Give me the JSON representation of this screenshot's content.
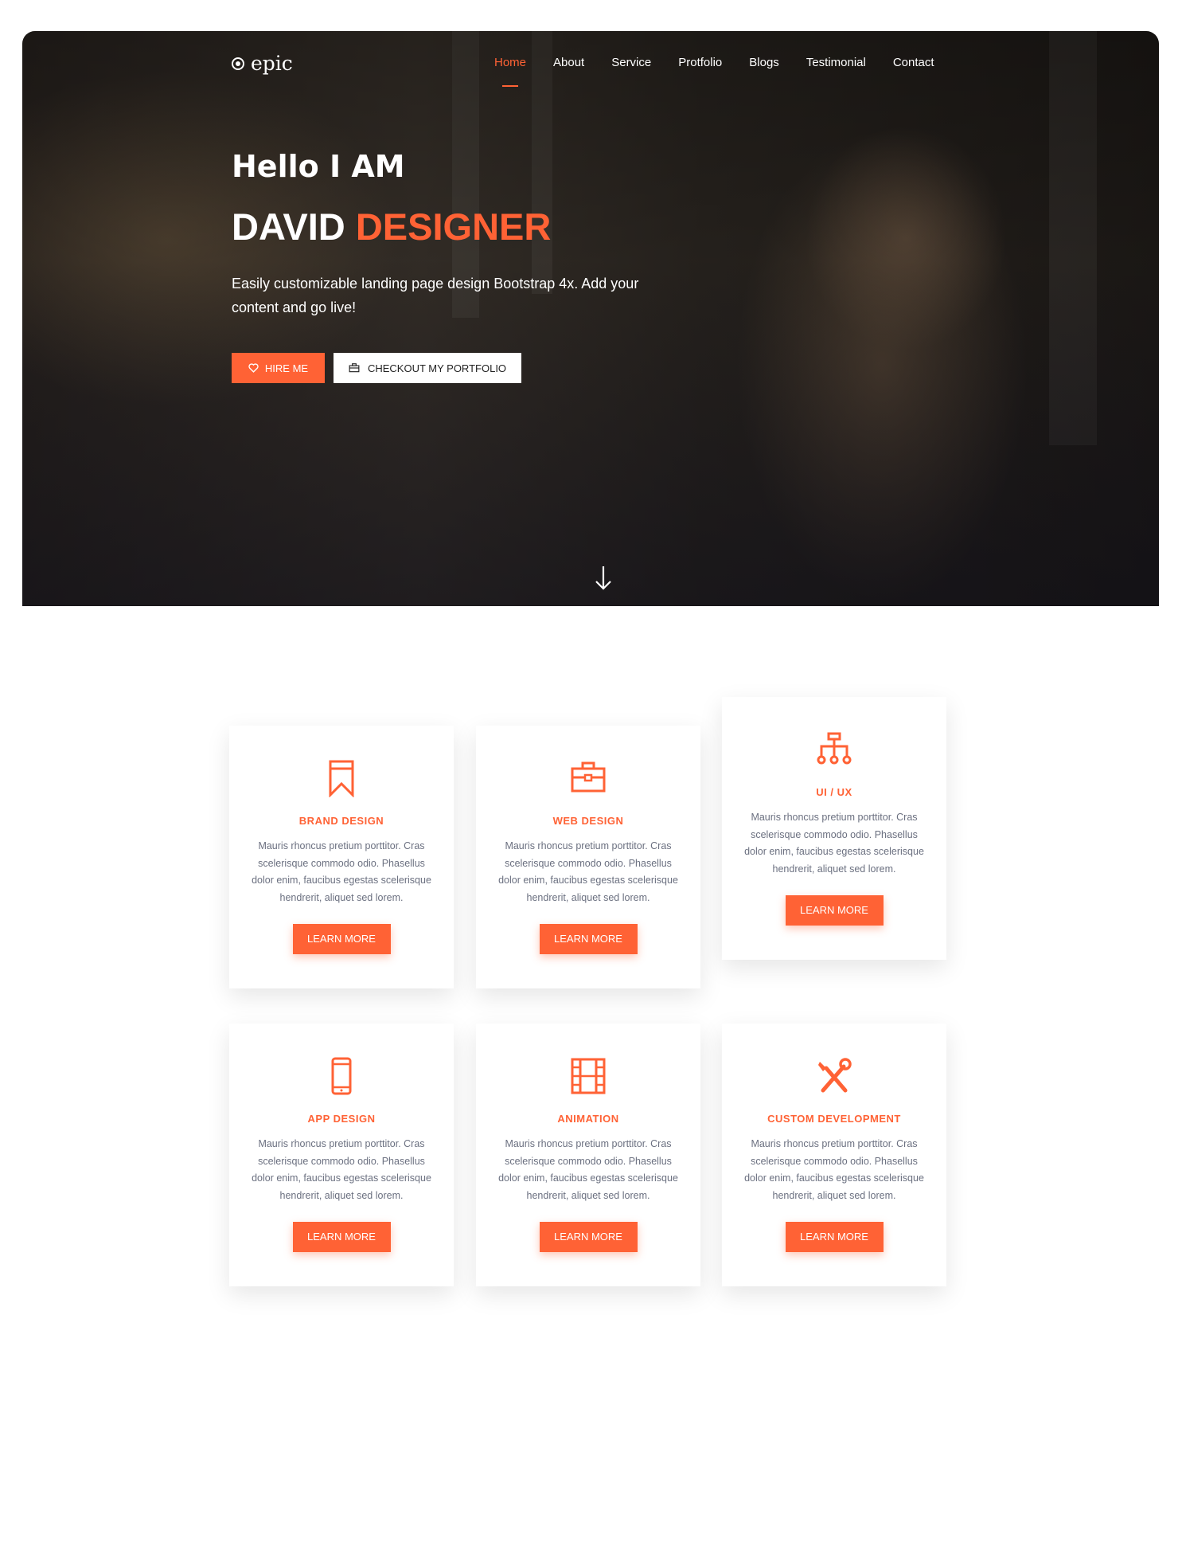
{
  "nav": {
    "logo": "epic",
    "items": [
      {
        "label": "Home",
        "active": true
      },
      {
        "label": "About",
        "active": false
      },
      {
        "label": "Service",
        "active": false
      },
      {
        "label": "Protfolio",
        "active": false
      },
      {
        "label": "Blogs",
        "active": false
      },
      {
        "label": "Testimonial",
        "active": false
      },
      {
        "label": "Contact",
        "active": false
      }
    ]
  },
  "hero": {
    "greeting": "Hello I AM",
    "name_first": "DAVID",
    "name_accent": "DESIGNER",
    "intro": "Easily customizable landing page design Bootstrap 4x. Add your content and go live!",
    "hire_button": "HIRE ME",
    "portfolio_button": "CHECKOUT MY PORTFOLIO",
    "hire_icon": "heart-icon",
    "portfolio_icon": "briefcase-icon",
    "scroll_icon": "arrow-down-icon"
  },
  "colors": {
    "accent": "#ff6235",
    "text_muted": "#6b7080"
  },
  "services": [
    {
      "title": "BRAND DESIGN",
      "icon": "bookmark-icon",
      "text": "Mauris rhoncus pretium porttitor. Cras scelerisque commodo odio. Phasellus dolor enim, faucibus egestas scelerisque hendrerit, aliquet sed lorem.",
      "button": "LEARN MORE"
    },
    {
      "title": "WEB DESIGN",
      "icon": "briefcase-icon",
      "text": "Mauris rhoncus pretium porttitor. Cras scelerisque commodo odio. Phasellus dolor enim, faucibus egestas scelerisque hendrerit, aliquet sed lorem.",
      "button": "LEARN MORE"
    },
    {
      "title": "UI / UX",
      "icon": "sitemap-icon",
      "text": "Mauris rhoncus pretium porttitor. Cras scelerisque commodo odio. Phasellus dolor enim, faucibus egestas scelerisque hendrerit, aliquet sed lorem.",
      "button": "LEARN MORE"
    },
    {
      "title": "APP DESIGN",
      "icon": "mobile-icon",
      "text": "Mauris rhoncus pretium porttitor. Cras scelerisque commodo odio. Phasellus dolor enim, faucibus egestas scelerisque hendrerit, aliquet sed lorem.",
      "button": "LEARN MORE"
    },
    {
      "title": "ANIMATION",
      "icon": "film-icon",
      "text": "Mauris rhoncus pretium porttitor. Cras scelerisque commodo odio. Phasellus dolor enim, faucibus egestas scelerisque hendrerit, aliquet sed lorem.",
      "button": "LEARN MORE"
    },
    {
      "title": "CUSTOM DEVELOPMENT",
      "icon": "tools-icon",
      "text": "Mauris rhoncus pretium porttitor. Cras scelerisque commodo odio. Phasellus dolor enim, faucibus egestas scelerisque hendrerit, aliquet sed lorem.",
      "button": "LEARN MORE"
    }
  ]
}
